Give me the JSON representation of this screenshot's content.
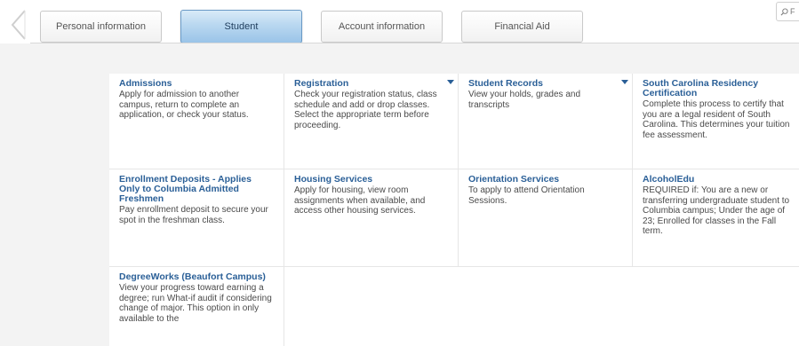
{
  "tabs": [
    {
      "label": "Personal information"
    },
    {
      "label": "Student"
    },
    {
      "label": "Account information"
    },
    {
      "label": "Financial Aid"
    }
  ],
  "search": {
    "placeholder": "F"
  },
  "cards": [
    {
      "title": "Admissions",
      "desc": "Apply for admission to another campus, return to complete an application, or check your status."
    },
    {
      "title": "Registration",
      "desc": "Check your registration status, class schedule and add or drop classes. Select the appropriate term before proceeding."
    },
    {
      "title": "Student Records",
      "desc": "View your holds, grades and transcripts"
    },
    {
      "title": "South Carolina Residency Certification",
      "desc": "Complete this process to certify that you are a legal resident of South Carolina. This determines your tuition fee assessment."
    },
    {
      "title": "Enrollment Deposits - Applies Only to Columbia Admitted Freshmen",
      "desc": "Pay enrollment deposit to secure your spot in the freshman class."
    },
    {
      "title": "Housing Services",
      "desc": "Apply for housing, view room assignments when available, and access other housing services."
    },
    {
      "title": "Orientation Services",
      "desc": "To apply to attend Orientation Sessions."
    },
    {
      "title": "AlcoholEdu",
      "desc": "REQUIRED if: You are a new or transferring undergraduate student to Columbia campus; Under the age of 23; Enrolled for classes in the Fall term."
    },
    {
      "title": "DegreeWorks (Beaufort Campus)",
      "desc": "View your progress toward earning a degree; run What-if audit if considering change of major. This option in only available to the"
    }
  ]
}
